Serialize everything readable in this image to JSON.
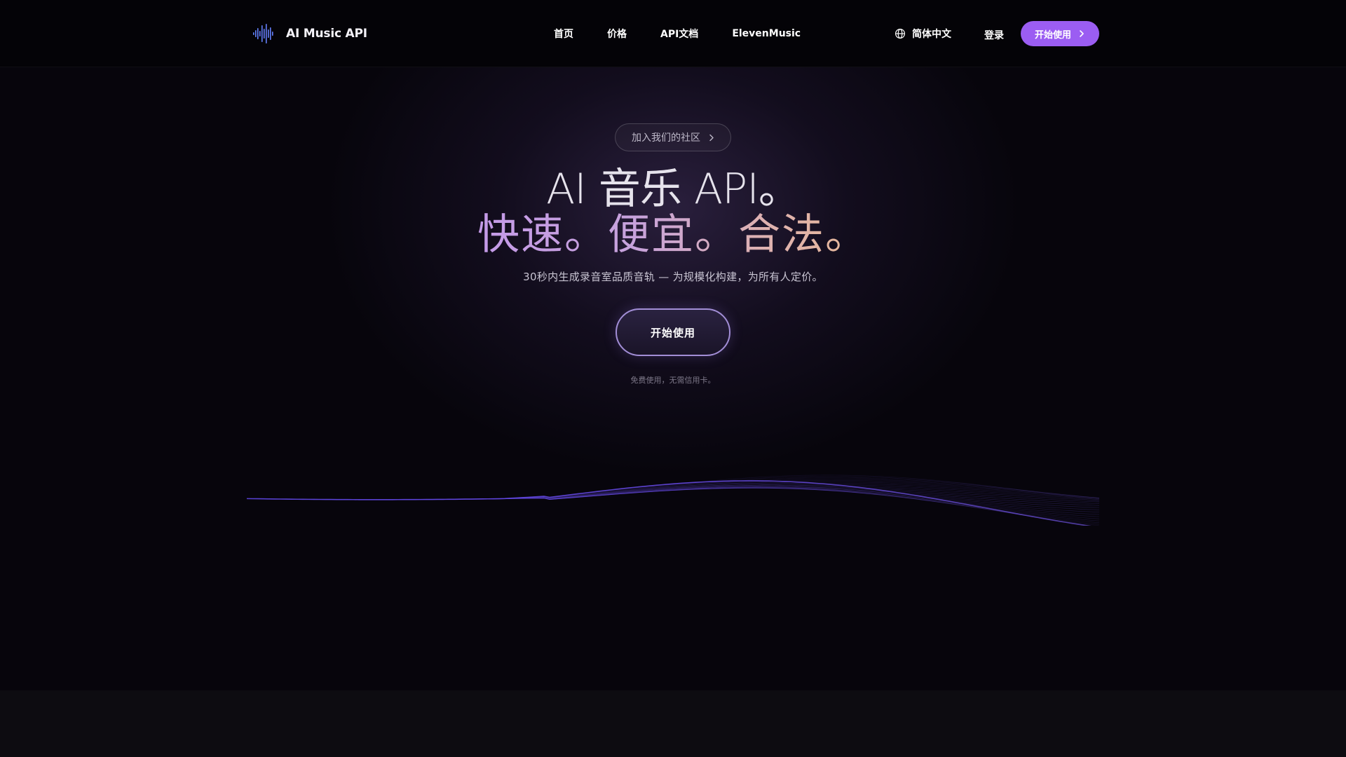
{
  "header": {
    "brand": "AI Music API",
    "nav": [
      {
        "label": "首页"
      },
      {
        "label": "价格"
      },
      {
        "label": "API文档"
      },
      {
        "label": "ElevenMusic"
      }
    ],
    "language": "简体中文",
    "login": "登录",
    "start_button": "开始使用",
    "icons": {
      "logo": "waveform-logo-icon",
      "language": "globe-icon",
      "start_button": "chevron-right-icon"
    }
  },
  "hero": {
    "community_pill": "加入我们的社区",
    "headline_line1": "AI 音乐 API。",
    "headline_line2": "快速。便宜。合法。",
    "subline": "30秒内生成录音室品质音轨 — 为规模化构建，为所有人定价。",
    "cta_button": "开始使用",
    "cta_note": "免费使用，无需信用卡。"
  },
  "colors": {
    "background": "#07050c",
    "accent": "#9b5df2",
    "gradient_start": "#c49ae8",
    "gradient_end": "#e8b996",
    "wave": "#6a4cf0"
  }
}
